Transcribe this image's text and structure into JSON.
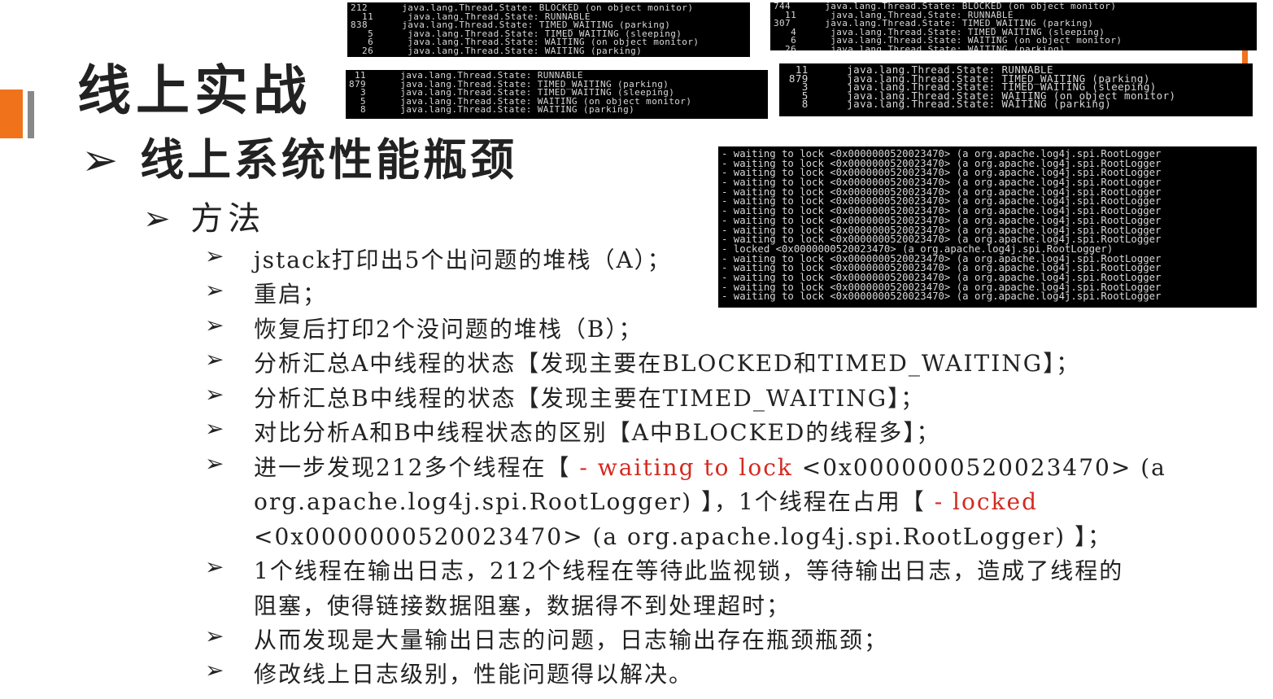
{
  "slide": {
    "title": "线上实战",
    "subtitle_arrow": "➢",
    "subtitle": "线上系统性能瓶颈",
    "section_arrow": "➢",
    "section": "方法",
    "bullet_glyph": "➢",
    "items": [
      {
        "text": "jstack打印出5个出问题的堆栈（A）；"
      },
      {
        "text": "重启；"
      },
      {
        "text": "恢复后打印2个没问题的堆栈（B）；"
      },
      {
        "text": "分析汇总A中线程的状态【发现主要在BLOCKED和TIMED_WAITING】；"
      },
      {
        "text": "分析汇总B中线程的状态【发现主要在TIMED_WAITING】；"
      },
      {
        "text": "对比分析A和B中线程状态的区别【A中BLOCKED的线程多】；"
      },
      {
        "p1": "进一步发现212多个线程在【 ",
        "r1": "- waiting to lock",
        "p2": " <0x0000000520023470> (a",
        "l2": "org.apache.log4j.spi.RootLogger) 】，1个线程在占用【 ",
        "r2": "- locked",
        "l3": "<0x0000000520023470> (a org.apache.log4j.spi.RootLogger) 】；"
      },
      {
        "l1": "1个线程在输出日志，212个线程在等待此监视锁，等待输出日志，造成了线程的",
        "l2": "阻塞，使得链接数据阻塞，数据得不到处理超时；"
      },
      {
        "text": "从而发现是大量输出日志的问题，日志输出存在瓶颈瓶颈；"
      },
      {
        "text": "修改线上日志级别，性能问题得以解决。"
      }
    ]
  },
  "terminals": {
    "a1": [
      "212      java.lang.Thread.State: BLOCKED (on object monitor)",
      "  11      java.lang.Thread.State: RUNNABLE",
      "838      java.lang.Thread.State: TIMED_WAITING (parking)",
      "   5      java.lang.Thread.State: TIMED_WAITING (sleeping)",
      "   6      java.lang.Thread.State: WAITING (on object monitor)",
      "  26      java.lang.Thread.State: WAITING (parking)"
    ],
    "a2": [
      "744      java.lang.Thread.State: BLOCKED (on object monitor)",
      "  11      java.lang.Thread.State: RUNNABLE",
      "307      java.lang.Thread.State: TIMED_WAITING (parking)",
      "   4      java.lang.Thread.State: TIMED_WAITING (sleeping)",
      "   6      java.lang.Thread.State: WAITING (on object monitor)",
      "  26      java.lang.Thread.State: WAITING (parking)"
    ],
    "b1": [
      " 11      java.lang.Thread.State: RUNNABLE",
      "879      java.lang.Thread.State: TIMED_WAITING (parking)",
      "  3      java.lang.Thread.State: TIMED_WAITING (sleeping)",
      "  5      java.lang.Thread.State: WAITING (on object monitor)",
      "  8      java.lang.Thread.State: WAITING (parking)"
    ],
    "b2": [
      "  11      java.lang.Thread.State: RUNNABLE",
      " 879      java.lang.Thread.State: TIMED_WAITING (parking)",
      "   3      java.lang.Thread.State: TIMED_WAITING (sleeping)",
      "   5      java.lang.Thread.State: WAITING (on object monitor)",
      "   8      java.lang.Thread.State: WAITING (parking)"
    ],
    "log": [
      "- waiting to lock <0x0000000520023470> (a org.apache.log4j.spi.RootLogger",
      "- waiting to lock <0x0000000520023470> (a org.apache.log4j.spi.RootLogger",
      "- waiting to lock <0x0000000520023470> (a org.apache.log4j.spi.RootLogger",
      "- waiting to lock <0x0000000520023470> (a org.apache.log4j.spi.RootLogger",
      "- waiting to lock <0x0000000520023470> (a org.apache.log4j.spi.RootLogger",
      "- waiting to lock <0x0000000520023470> (a org.apache.log4j.spi.RootLogger",
      "- waiting to lock <0x0000000520023470> (a org.apache.log4j.spi.RootLogger",
      "- waiting to lock <0x0000000520023470> (a org.apache.log4j.spi.RootLogger",
      "- waiting to lock <0x0000000520023470> (a org.apache.log4j.spi.RootLogger",
      "- waiting to lock <0x0000000520023470> (a org.apache.log4j.spi.RootLogger",
      "- locked <0x0000000520023470> (a org.apache.log4j.spi.RootLogger)",
      "- waiting to lock <0x0000000520023470> (a org.apache.log4j.spi.RootLogger",
      "- waiting to lock <0x0000000520023470> (a org.apache.log4j.spi.RootLogger",
      "- waiting to lock <0x0000000520023470> (a org.apache.log4j.spi.RootLogger",
      "- waiting to lock <0x0000000520023470> (a org.apache.log4j.spi.RootLogger",
      "- waiting to lock <0x0000000520023470> (a org.apache.log4j.spi.RootLogger"
    ]
  },
  "colors": {
    "accent": "#f0731c",
    "highlight": "#d42a20"
  }
}
